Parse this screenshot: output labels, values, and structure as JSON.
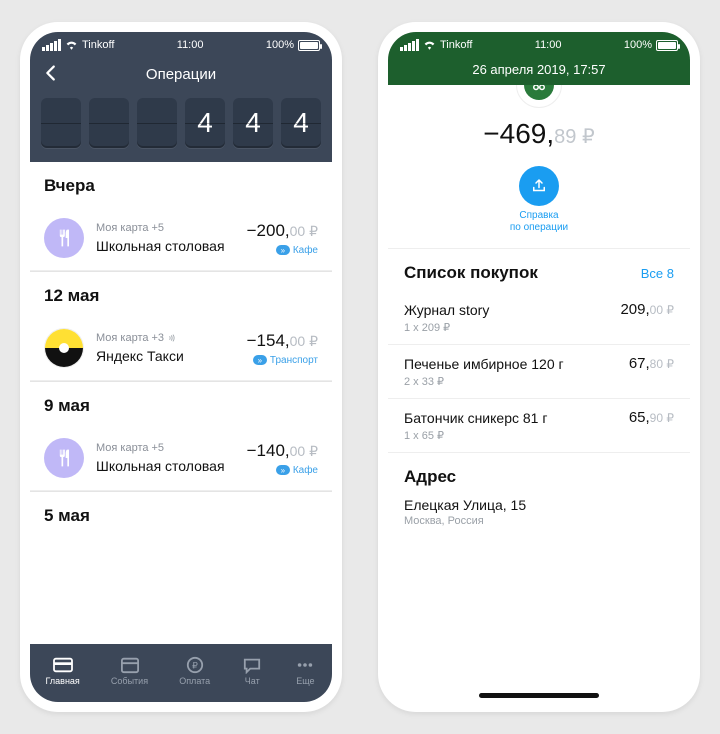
{
  "status": {
    "carrier": "Tinkoff",
    "time": "11:00",
    "battery": "100%"
  },
  "phone1": {
    "title": "Операции",
    "counter_digits": [
      "",
      "",
      "",
      "4",
      "4",
      "4"
    ],
    "groups": [
      {
        "header": "Вчера",
        "items": [
          {
            "icon": "fork",
            "card_label": "Моя карта",
            "card_extra": "+5",
            "merchant": "Школьная столовая",
            "amount_major": "−200,",
            "amount_minor": "00 ₽",
            "tag": "Кафе"
          }
        ]
      },
      {
        "header": "12 мая",
        "items": [
          {
            "icon": "yandex",
            "card_label": "Моя карта",
            "card_extra": "+3",
            "merchant": "Яндекс Такси",
            "amount_major": "−154,",
            "amount_minor": "00 ₽",
            "tag": "Транспорт",
            "contactless": true
          }
        ]
      },
      {
        "header": "9 мая",
        "items": [
          {
            "icon": "fork",
            "card_label": "Моя карта",
            "card_extra": "+5",
            "merchant": "Школьная столовая",
            "amount_major": "−140,",
            "amount_minor": "00 ₽",
            "tag": "Кафе"
          }
        ]
      },
      {
        "header": "5 мая",
        "items": []
      }
    ],
    "tabs": [
      {
        "label": "Главная"
      },
      {
        "label": "События"
      },
      {
        "label": "Оплата"
      },
      {
        "label": "Чат"
      },
      {
        "label": "Еще"
      }
    ]
  },
  "phone2": {
    "datetime": "26 апреля 2019, 17:57",
    "amount_major": "−469,",
    "amount_minor": "89 ₽",
    "action_label_1": "Справка",
    "action_label_2": "по операции",
    "list_title": "Список покупок",
    "list_more": "Все 8",
    "items": [
      {
        "name": "Журнал story",
        "qty": "1 x 209 ₽",
        "price_major": "209,",
        "price_minor": "00 ₽"
      },
      {
        "name": "Печенье имбирное 120 г",
        "qty": "2 x 33 ₽",
        "price_major": "67,",
        "price_minor": "80 ₽"
      },
      {
        "name": "Батончик сникерс 81 г",
        "qty": "1 x 65 ₽",
        "price_major": "65,",
        "price_minor": "90 ₽"
      }
    ],
    "address_title": "Адрес",
    "address_line": "Елецкая Улица, 15",
    "address_sub": "Москва, Россия"
  }
}
